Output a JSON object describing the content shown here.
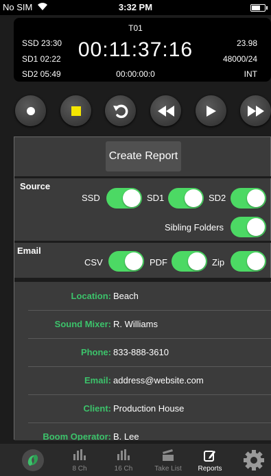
{
  "status_bar": {
    "carrier": "No SIM",
    "time": "3:32 PM"
  },
  "timecode": {
    "take": "T01",
    "ssd": "SSD 23:30",
    "sd1": "SD1 02:22",
    "sd2": "SD2 05:49",
    "main": "00:11:37:16",
    "sub": "00:00:00:0",
    "fps": "23.98",
    "sample_rate": "48000/24",
    "source": "INT"
  },
  "transport": [
    "record-icon",
    "stop-icon",
    "undo-icon",
    "rewind-icon",
    "play-icon",
    "fast-forward-icon"
  ],
  "report": {
    "create_label": "Create Report",
    "source": {
      "title": "Source",
      "ssd": "SSD",
      "sd1": "SD1",
      "sd2": "SD2",
      "sibling": "Sibling Folders"
    },
    "email": {
      "title": "Email",
      "csv": "CSV",
      "pdf": "PDF",
      "zip": "Zip"
    },
    "fields": [
      {
        "key": "Location:",
        "value": "Beach"
      },
      {
        "key": "Sound Mixer:",
        "value": "R. Williams"
      },
      {
        "key": "Phone:",
        "value": "833-888-3610"
      },
      {
        "key": "Email:",
        "value": "address@website.com"
      },
      {
        "key": "Client:",
        "value": "Production House"
      },
      {
        "key": "Boom Operator:",
        "value": "B. Lee"
      }
    ]
  },
  "tabs": {
    "ch8": "8 Ch",
    "ch16": "16 Ch",
    "takelist": "Take List",
    "reports": "Reports"
  },
  "colors": {
    "accent_green": "#4cd964",
    "label_green": "#3cc36b",
    "stop_yellow": "#f5e600"
  }
}
